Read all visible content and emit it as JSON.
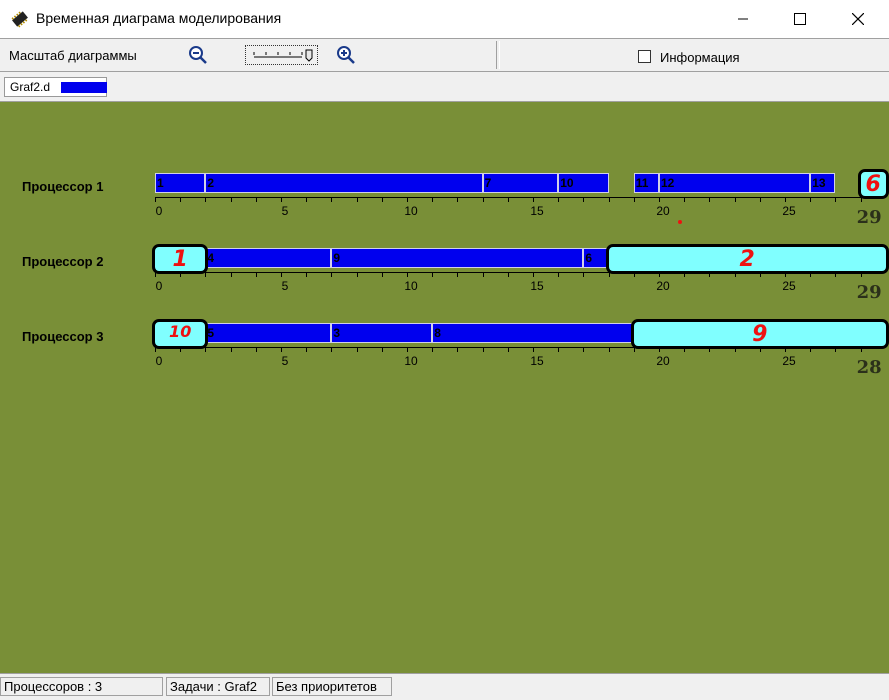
{
  "window": {
    "title": "Временная диаграма моделирования",
    "icon": "chip-icon",
    "controls": [
      "minimize-icon",
      "maximize-icon",
      "close-icon"
    ]
  },
  "toolbar": {
    "scale_label": "Масштаб диаграммы",
    "zoom_out_icon": "zoom-out-icon",
    "zoom_in_icon": "zoom-in-icon",
    "info_label": "Информация",
    "info_checked": false
  },
  "file": {
    "name": "Graf2.d"
  },
  "colors": {
    "background": "#798f37",
    "task": "#0000ee",
    "overlay": "#80ffff",
    "annotation": "#ee1111"
  },
  "processors": [
    {
      "label": "Процессор 1",
      "tasks": [
        {
          "id": "1",
          "start": 0,
          "end": 2
        },
        {
          "id": "2",
          "start": 2,
          "end": 13
        },
        {
          "id": "7",
          "start": 13,
          "end": 16
        },
        {
          "id": "10",
          "start": 16,
          "end": 18
        },
        {
          "id": "11",
          "start": 19,
          "end": 20
        },
        {
          "id": "12",
          "start": 20,
          "end": 26
        },
        {
          "id": "13",
          "start": 26,
          "end": 27
        }
      ],
      "ticks": [
        "0",
        "5",
        "10",
        "15",
        "20",
        "25"
      ],
      "overlays": [
        {
          "start": 28,
          "end": 29,
          "annotation": "6"
        }
      ],
      "end_note": "29"
    },
    {
      "label": "Процессор 2",
      "tasks": [
        {
          "id": "4",
          "start": 2,
          "end": 7
        },
        {
          "id": "9",
          "start": 7,
          "end": 17
        },
        {
          "id": "6",
          "start": 17,
          "end": 18
        }
      ],
      "ticks": [
        "0",
        "5",
        "10",
        "15",
        "20",
        "25"
      ],
      "overlays": [
        {
          "start": 0,
          "end": 2,
          "annotation": "1"
        },
        {
          "start": 18,
          "end": 29,
          "annotation": "2"
        }
      ],
      "end_note": "29"
    },
    {
      "label": "Процессор 3",
      "tasks": [
        {
          "id": "5",
          "start": 2,
          "end": 7
        },
        {
          "id": "3",
          "start": 7,
          "end": 11
        },
        {
          "id": "8",
          "start": 11,
          "end": 19
        }
      ],
      "ticks": [
        "0",
        "5",
        "10",
        "15",
        "20",
        "25"
      ],
      "overlays": [
        {
          "start": 0,
          "end": 2,
          "annotation": "10"
        },
        {
          "start": 19,
          "end": 29,
          "annotation": "9"
        }
      ],
      "end_note": "28"
    }
  ],
  "status": {
    "processors": "Процессоров : 3",
    "tasks_label": "Задачи :",
    "tasks_value": "Graf2",
    "priority": "Без приоритетов"
  }
}
